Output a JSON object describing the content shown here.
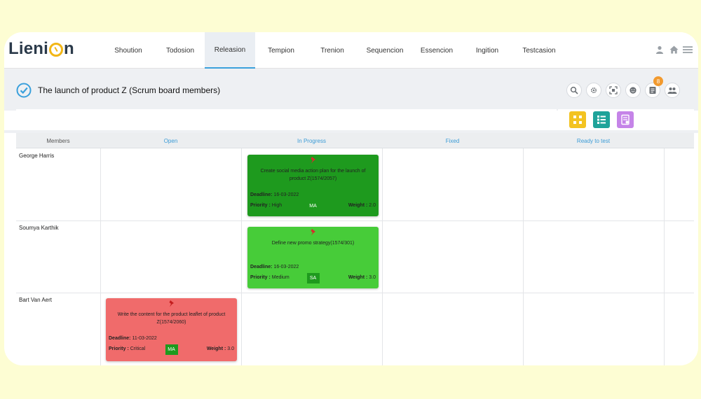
{
  "app": {
    "logo_text_left": "Lieni",
    "logo_text_right": "n"
  },
  "nav": {
    "items": [
      {
        "label": "Shoution"
      },
      {
        "label": "Todosion"
      },
      {
        "label": "Releasion"
      },
      {
        "label": "Tempion"
      },
      {
        "label": "Trenion"
      },
      {
        "label": "Sequencion"
      },
      {
        "label": "Essencion"
      },
      {
        "label": "Ingition"
      },
      {
        "label": "Testcasion"
      }
    ],
    "active": "Releasion",
    "right_icons": [
      "user-icon",
      "home-icon",
      "menu-icon"
    ]
  },
  "header": {
    "title": "The launch of product Z (Scrum board members)",
    "tools": [
      "search-icon",
      "settings-icon",
      "focus-icon",
      "face-icon",
      "notes-icon",
      "team-icon"
    ],
    "notification_count": "8"
  },
  "views": {
    "buttons": [
      {
        "name": "kanban-view-icon",
        "color": "#f3c321"
      },
      {
        "name": "list-view-icon",
        "color": "#1fa39a"
      },
      {
        "name": "report-view-icon",
        "color": "#c584e8"
      }
    ]
  },
  "board": {
    "columns": {
      "members": "Members",
      "open": "Open",
      "in_progress": "In Progress",
      "fixed": "Fixed",
      "ready": "Ready to test"
    },
    "members": [
      "George Harris",
      "Soumya Karthik",
      "Bart Van Aert"
    ],
    "cards": [
      {
        "desc": "Create social media action plan for the launch of product Z(1574/2057)",
        "deadline_label": "Deadline:",
        "deadline": "16-03-2022",
        "priority_label": "Priority :",
        "priority": "High",
        "avatar": "MA",
        "weight_label": "Weight :",
        "weight": "2.0",
        "color": "#1e9a1e"
      },
      {
        "desc": "Define new promo strategy(1574/301)",
        "deadline_label": "Deadline:",
        "deadline": "16-03-2022",
        "priority_label": "Priority :",
        "priority": "Medium",
        "avatar": "SA",
        "weight_label": "Weight :",
        "weight": "3.0",
        "color": "#47cc39"
      },
      {
        "desc": "Write the content for the product leaflet of product Z(1574/2060)",
        "deadline_label": "Deadline:",
        "deadline": "11-03-2022",
        "priority_label": "Priority :",
        "priority": "Critical",
        "avatar": "MA",
        "weight_label": "Weight :",
        "weight": "3.0",
        "color": "#f06b6b"
      }
    ]
  }
}
